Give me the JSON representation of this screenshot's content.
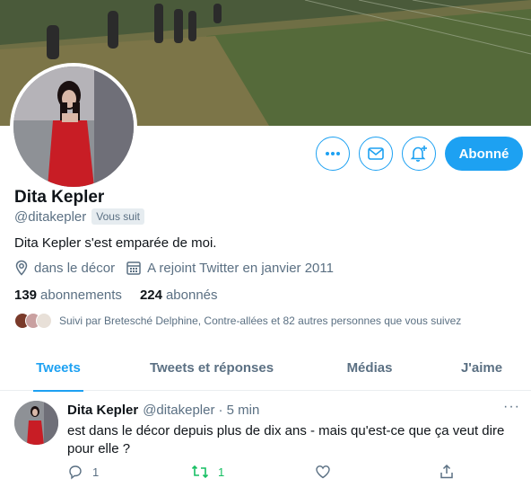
{
  "profile": {
    "name": "Dita Kepler",
    "handle": "@ditakepler",
    "follows_you": "Vous suit",
    "bio": "Dita Kepler s'est emparée de moi.",
    "location": "dans le décor",
    "joined": "A rejoint Twitter en janvier 2011",
    "following_count": "139",
    "following_label": "abonnements",
    "followers_count": "224",
    "followers_label": "abonnés",
    "followed_by": "Suivi par Bretesché Delphine, Contre-allées et 82 autres personnes que vous suivez"
  },
  "actions": {
    "follow_label": "Abonné",
    "more_icon": "more-icon",
    "message_icon": "envelope-icon",
    "notify_icon": "bell-plus-icon"
  },
  "tabs": [
    {
      "label": "Tweets",
      "active": true
    },
    {
      "label": "Tweets et réponses",
      "active": false
    },
    {
      "label": "Médias",
      "active": false
    },
    {
      "label": "J'aime",
      "active": false
    }
  ],
  "tweet": {
    "name": "Dita Kepler",
    "handle": "@ditakepler",
    "time": "· 5 min",
    "text": "est dans le décor depuis plus de dix ans - mais qu'est-ce que ça veut dire pour elle ?",
    "replies": "1",
    "retweets": "1",
    "more": "···"
  },
  "colors": {
    "accent": "#1da1f2",
    "retweet": "#17bf63",
    "muted": "#5b7083"
  }
}
